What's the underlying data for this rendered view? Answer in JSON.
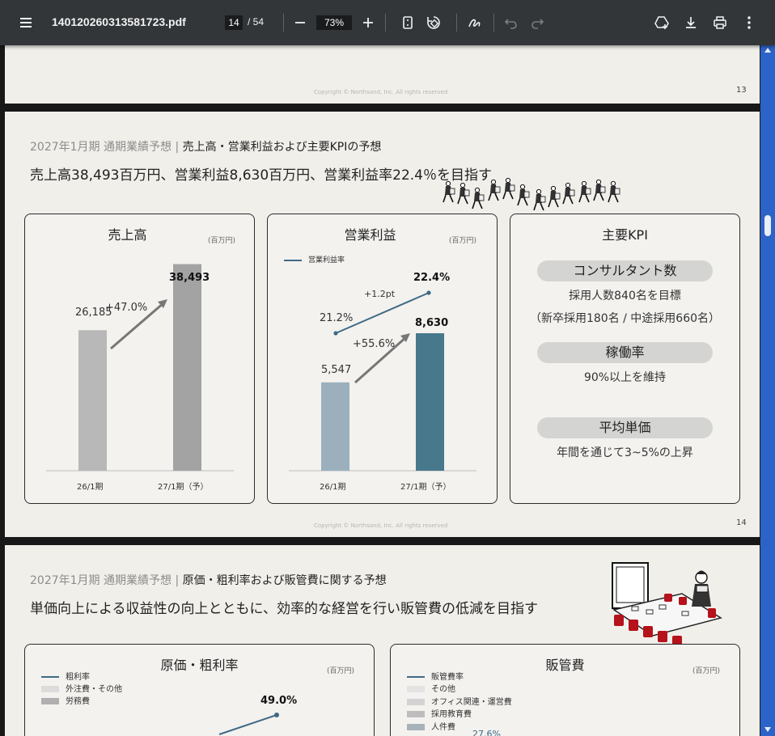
{
  "toolbar": {
    "filename": "140120260313581723.pdf",
    "current_page": "14",
    "total_pages": "/ 54",
    "zoom": "73%"
  },
  "page13": {
    "page_number": "13",
    "copyright": "Copyright © Northsand, Inc. All rights reserved"
  },
  "page14": {
    "section": "2027年1月期 通期業績予想",
    "divider": "|",
    "topic": "売上高・営業利益および主要KPIの予想",
    "headline": "売上高38,493百万円、営業利益8,630百万円、営業利益率22.4％を目指す",
    "page_number": "14",
    "copyright": "Copyright © Northsand, Inc. All rights reserved",
    "revenue": {
      "title": "売上高",
      "unit": "(百万円)",
      "growth": "+47.0%",
      "bar1_label": "26,185",
      "bar2_label": "38,493",
      "x1": "26/1期",
      "x2": "27/1期（予）"
    },
    "op_income": {
      "title": "営業利益",
      "unit": "(百万円)",
      "legend": "営業利益率",
      "margin1": "21.2%",
      "margin2": "22.4%",
      "margin_change": "+1.2pt",
      "growth": "+55.6%",
      "bar1_label": "5,547",
      "bar2_label": "8,630",
      "x1": "26/1期",
      "x2": "27/1期（予）"
    },
    "kpi": {
      "title": "主要KPI",
      "item1_pill": "コンサルタント数",
      "item1_line1": "採用人数840名を目標",
      "item1_line2": "（新卒採用180名 / 中途採用660名）",
      "item2_pill": "稼働率",
      "item2_line1": "90%以上を維持",
      "item3_pill": "平均単価",
      "item3_line1": "年間を通じて3~5%の上昇"
    }
  },
  "page15": {
    "section": "2027年1月期 通期業績予想",
    "divider": "|",
    "topic": "原価・粗利率および販管費に関する予想",
    "headline": "単価向上による収益性の向上とともに、効率的な経営を行い販管費の低減を目指す",
    "cost": {
      "title": "原価・粗利率",
      "unit": "(百万円)",
      "legend": [
        "粗利率",
        "外注費・その他",
        "労務費"
      ],
      "margin_label": "49.0%"
    },
    "sga": {
      "title": "販管費",
      "unit": "(百万円)",
      "legend": [
        "販管費率",
        "その他",
        "オフィス関連・運営費",
        "採用教育費",
        "人件費"
      ],
      "partial_label": "27.6%"
    }
  },
  "chart_data": [
    {
      "type": "bar",
      "title": "売上高",
      "unit": "百万円",
      "categories": [
        "26/1期",
        "27/1期（予）"
      ],
      "values": [
        26185,
        38493
      ],
      "annotations": [
        "+47.0%"
      ]
    },
    {
      "type": "bar",
      "title": "営業利益",
      "unit": "百万円",
      "categories": [
        "26/1期",
        "27/1期（予）"
      ],
      "series": [
        {
          "name": "営業利益",
          "values": [
            5547,
            8630
          ]
        },
        {
          "name": "営業利益率",
          "values": [
            21.2,
            22.4
          ]
        }
      ],
      "annotations": [
        "+55.6%",
        "+1.2pt"
      ]
    }
  ],
  "colors": {
    "toolbar_bg": "#323639",
    "page_bg": "#f1efea",
    "bar_gray_light": "#b8b8b8",
    "bar_gray_dark": "#a3a3a3",
    "bar_teal_light": "#9bb0bc",
    "bar_teal_dark": "#48788c",
    "margin_line": "#3f6a85",
    "scrollbar": "#2c63c8"
  }
}
